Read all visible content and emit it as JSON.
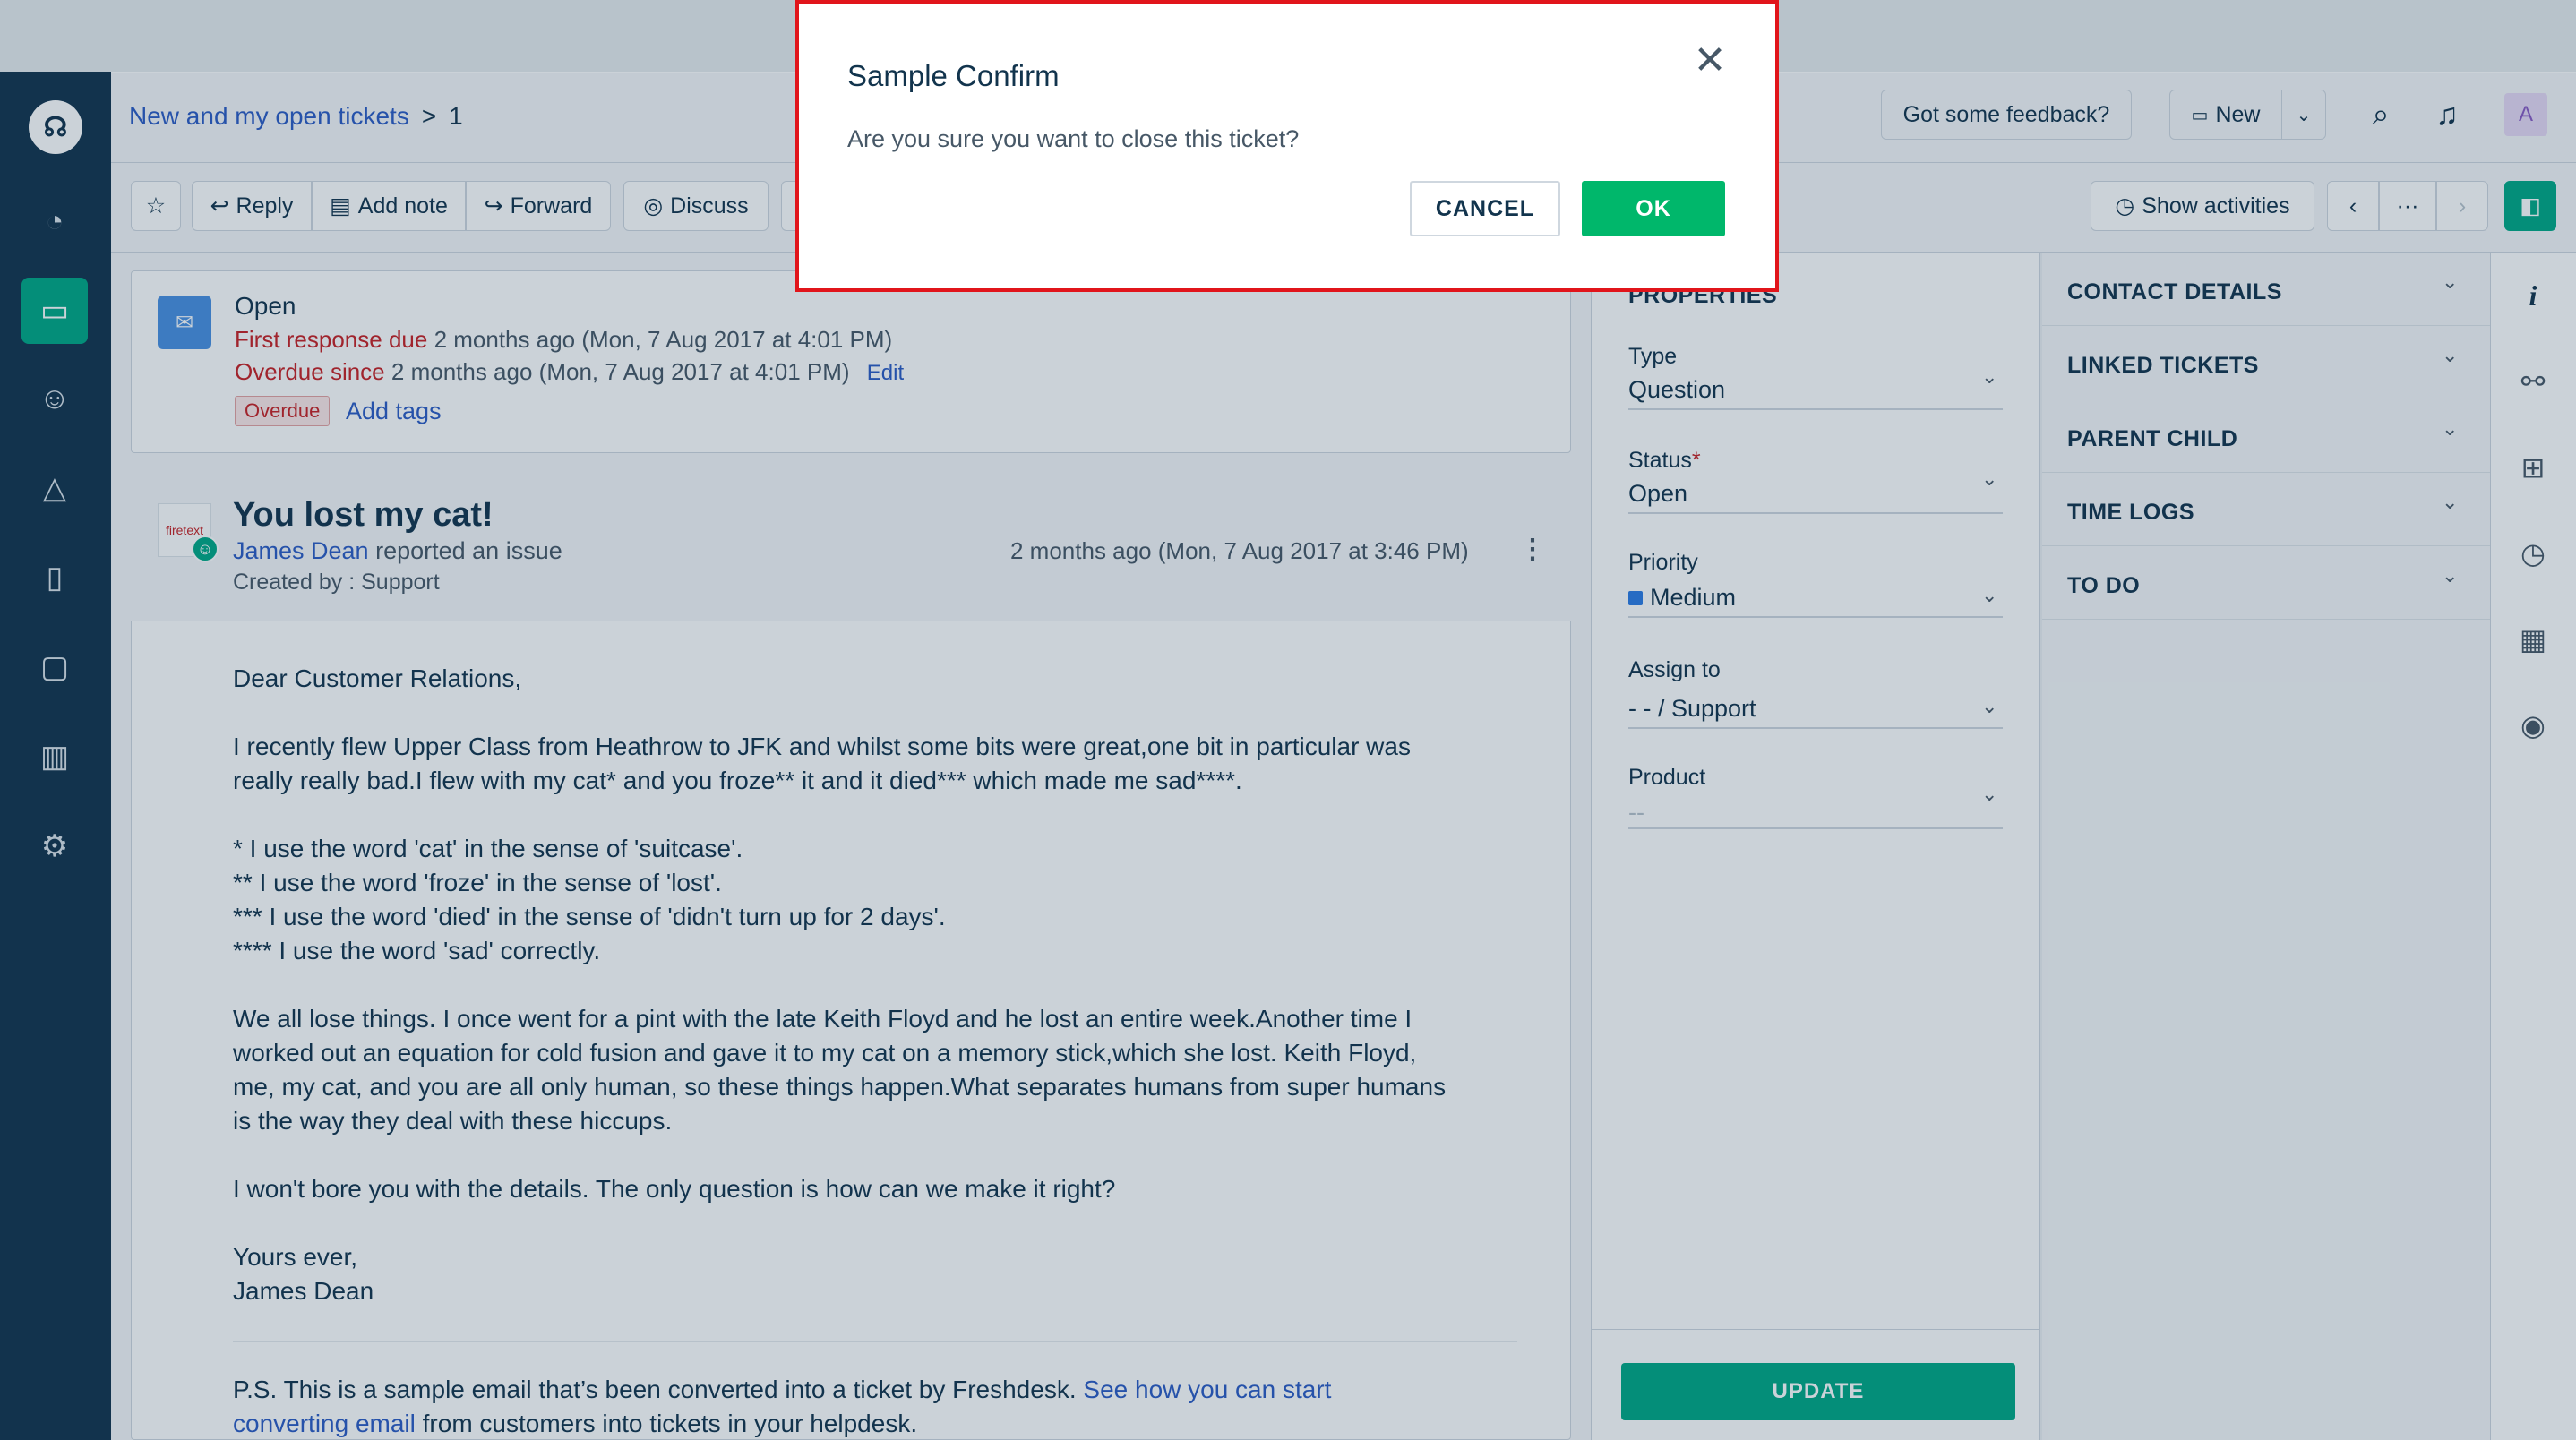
{
  "nav": {
    "items": [
      {
        "icon": "headset-icon",
        "glyph": "☊"
      },
      {
        "icon": "dashboard-icon",
        "glyph": "◔"
      },
      {
        "icon": "tickets-icon",
        "glyph": "▭"
      },
      {
        "icon": "contacts-icon",
        "glyph": "☺"
      },
      {
        "icon": "social-icon",
        "glyph": "△"
      },
      {
        "icon": "solutions-icon",
        "glyph": "▯"
      },
      {
        "icon": "forums-icon",
        "glyph": "▢"
      },
      {
        "icon": "reports-icon",
        "glyph": "▥"
      },
      {
        "icon": "admin-icon",
        "glyph": "⚙"
      }
    ]
  },
  "header": {
    "breadcrumb_link": "New and my open tickets",
    "breadcrumb_sep": ">",
    "breadcrumb_current": "1",
    "feedback_label": "Got some feedback?",
    "new_label": "New",
    "avatar_initial": "A"
  },
  "toolbar": {
    "reply_label": "Reply",
    "add_note_label": "Add note",
    "forward_label": "Forward",
    "discuss_label": "Discuss",
    "show_activities_label": "Show activities",
    "more_label": "···"
  },
  "status": {
    "state": "Open",
    "first_response_label": "First response due",
    "first_response_value": "2 months ago (Mon, 7 Aug 2017 at 4:01 PM)",
    "overdue_label": "Overdue since",
    "overdue_value": "2 months ago (Mon, 7 Aug 2017 at 4:01 PM)",
    "edit_label": "Edit",
    "badge": "Overdue",
    "add_tags_label": "Add tags"
  },
  "ticket": {
    "avatar_text": "firetext",
    "title": "You lost my cat!",
    "requester": "James Dean",
    "action": "reported an issue",
    "created_by": "Created by : Support",
    "timestamp": "2 months ago (Mon, 7 Aug 2017 at 3:46 PM)",
    "body": [
      "Dear Customer Relations,",
      "I recently flew Upper Class from Heathrow to JFK and whilst some bits were great,one bit in particular was",
      "really really bad.I flew with my cat* and you froze** it and it died*** which made me sad****.",
      "* I use the word 'cat' in the sense of 'suitcase'.",
      "** I use the word 'froze' in the sense of 'lost'.",
      "*** I use the word 'died' in the sense of 'didn't turn up for 2 days'.",
      "**** I use the word 'sad' correctly.",
      "We all lose things. I once went for a pint with the late Keith Floyd and he lost an entire week.Another time I",
      "worked out an equation for cold fusion and gave it to my cat on a memory stick,which she lost. Keith Floyd,",
      "me, my cat, and you are all only human, so these things happen.What separates humans from super humans",
      "is the way they deal with these hiccups.",
      "I won't bore you with the details. The only question is how can we make it right?",
      "Yours ever,",
      "James Dean"
    ],
    "ps_prefix": "P.S. This is a sample email that’s been converted into a ticket by Freshdesk.",
    "ps_link1": "See how you can start",
    "ps_link2": "converting email",
    "ps_suffix": "from customers into tickets in your helpdesk."
  },
  "properties": {
    "heading": "PROPERTIES",
    "type_label": "Type",
    "type_value": "Question",
    "status_label": "Status",
    "status_required": "*",
    "status_value": "Open",
    "priority_label": "Priority",
    "priority_value": "Medium",
    "priority_color": "#2c7be5",
    "assign_label": "Assign to",
    "assign_value": "- - / Support",
    "product_label": "Product",
    "product_value": "--",
    "update_label": "UPDATE"
  },
  "sidebar_sections": [
    "CONTACT DETAILS",
    "LINKED TICKETS",
    "PARENT CHILD",
    "TIME LOGS",
    "TO DO"
  ],
  "rail_icons": [
    "info-icon",
    "link-icon",
    "hierarchy-icon",
    "timer-icon",
    "calendar-icon",
    "app-icon"
  ],
  "dialog": {
    "title": "Sample Confirm",
    "message": "Are you sure you want to close this ticket?",
    "cancel_label": "CANCEL",
    "ok_label": "OK",
    "close_glyph": "✕"
  },
  "colors": {
    "accent": "#00a886",
    "ok": "#00b76b",
    "nav_bg": "#12344d",
    "dialog_border": "#e1151b"
  }
}
